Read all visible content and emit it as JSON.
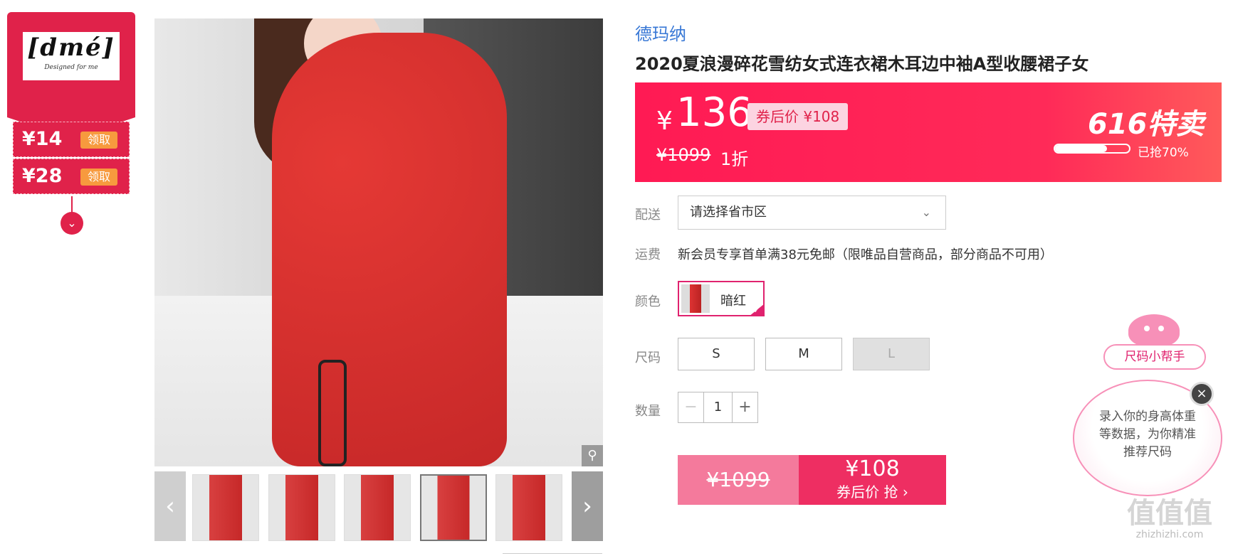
{
  "brand_card": {
    "logo_text": "[dmé]",
    "logo_tagline": "Designed for me"
  },
  "coupons": [
    {
      "amount": "¥14",
      "action": "领取"
    },
    {
      "amount": "¥28",
      "action": "领取"
    }
  ],
  "collapse_icon": "chevron-down-icon",
  "gallery": {
    "zoom_icon": "magnifier-icon",
    "prev_icon": "‹",
    "next_icon": "›",
    "thumbnail_count": 6
  },
  "product": {
    "brand": "德玛纳",
    "title": "2020夏浪漫碎花雪纺女式连衣裙木耳边中袖A型收腰裙子女"
  },
  "price": {
    "currency": "¥",
    "current": "136",
    "after_coupon": "券后价 ¥108",
    "original": "¥1099",
    "discount": "1折",
    "promo": "616特卖",
    "sold_fraction": 0.7,
    "sold_text": "已抢70%"
  },
  "delivery": {
    "label": "配送",
    "placeholder": "请选择省市区"
  },
  "shipping": {
    "label": "运费",
    "text": "新会员专享首单满38元免邮（限唯品自营商品，部分商品不可用）"
  },
  "color": {
    "label": "颜色",
    "selected": "暗红"
  },
  "size": {
    "label": "尺码",
    "options": [
      "S",
      "M",
      "L"
    ],
    "disabled": [
      "L"
    ]
  },
  "quantity": {
    "label": "数量",
    "value": "1",
    "minus": "−",
    "plus": "+"
  },
  "buy": {
    "original": "¥1099",
    "price": "¥108",
    "action": "券后价 抢 ›"
  },
  "size_helper": {
    "tag": "尺码小帮手",
    "message": "录入你的身高体重等数据，为你精准推荐尺码",
    "close": "×"
  },
  "watermark": {
    "logo": "值值值",
    "site": "zhizhizhi.com"
  },
  "colors": {
    "accent": "#e0224a",
    "banner": "#ff1a54",
    "link": "#3a79d6",
    "helper_pink": "#f790b8"
  }
}
